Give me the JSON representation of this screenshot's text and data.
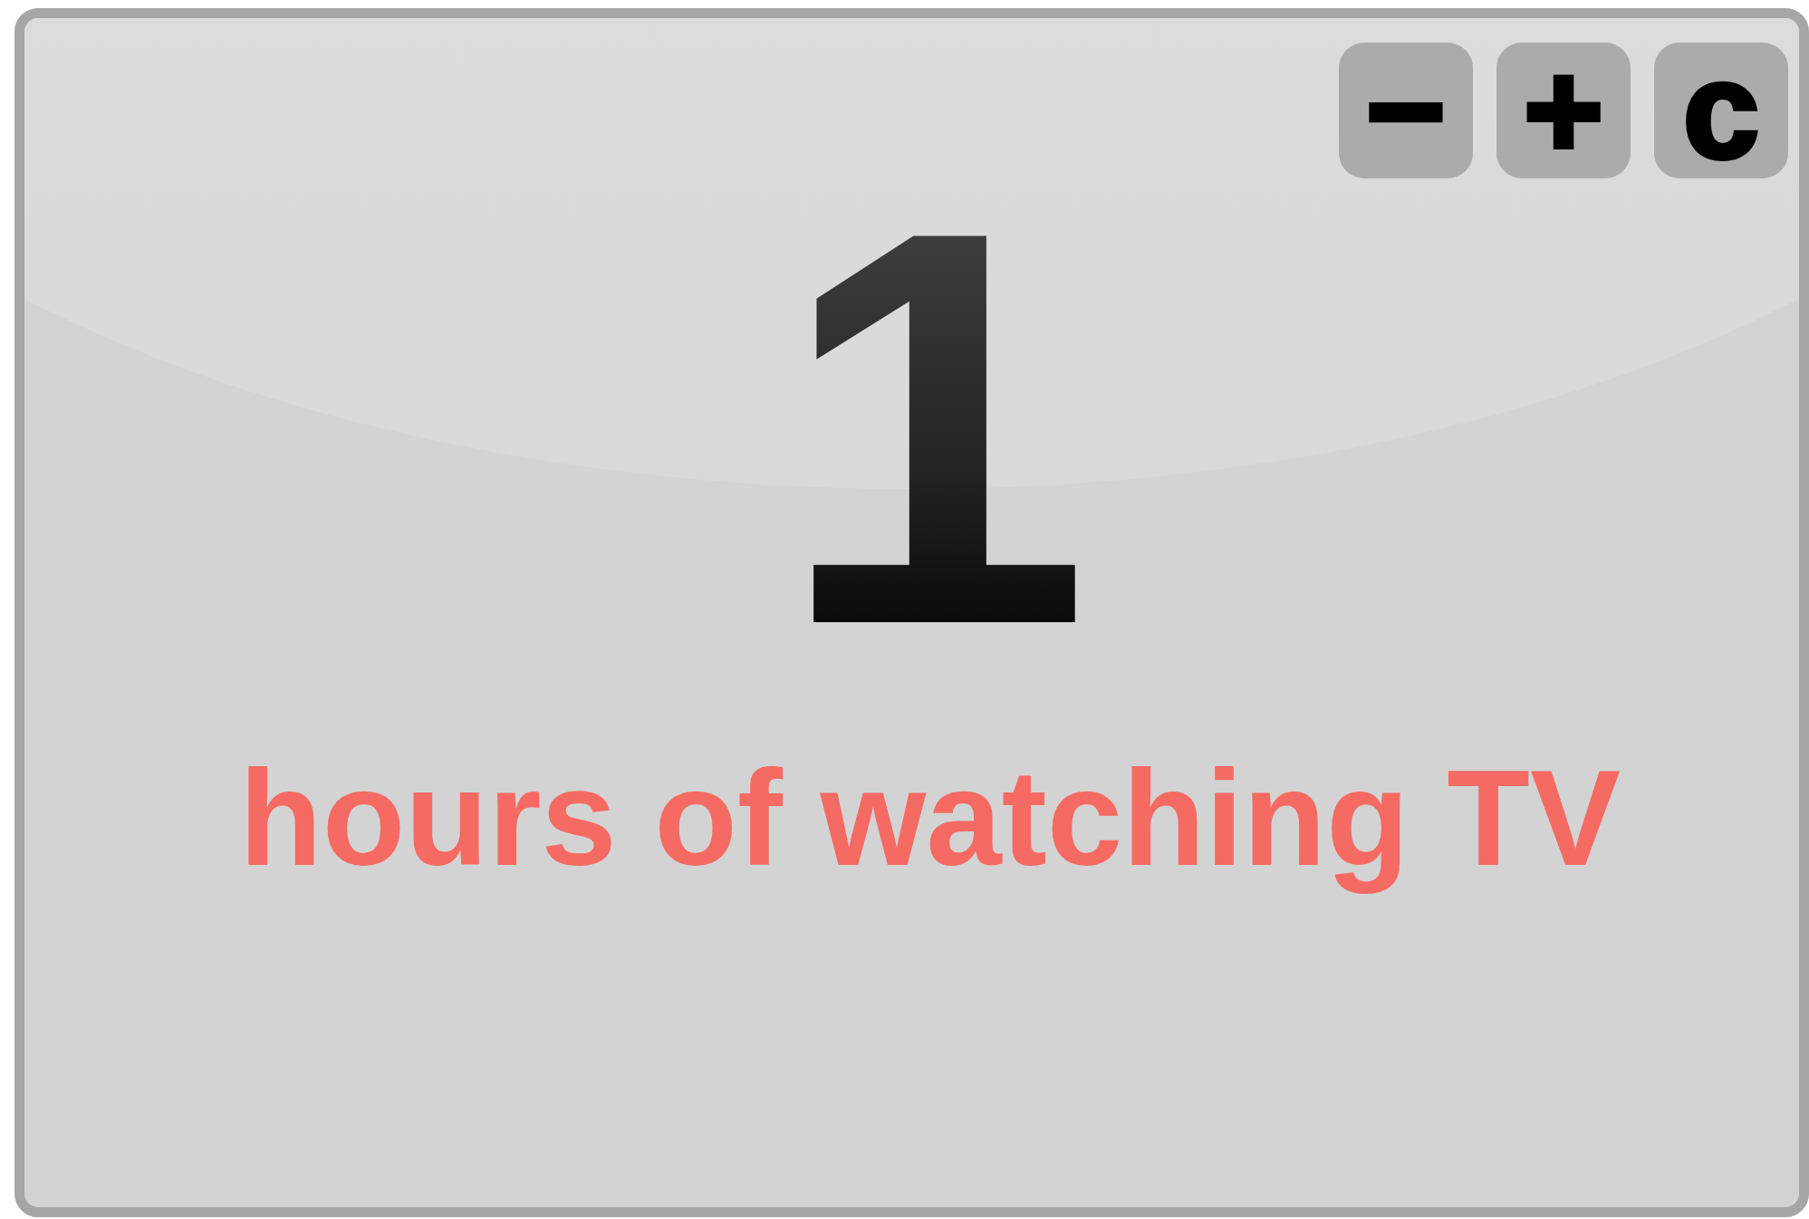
{
  "buttons": [
    {
      "label": "−"
    },
    {
      "label": "+"
    },
    {
      "label": "c"
    }
  ],
  "counter": {
    "value": "1",
    "label": "hours of watching TV"
  }
}
